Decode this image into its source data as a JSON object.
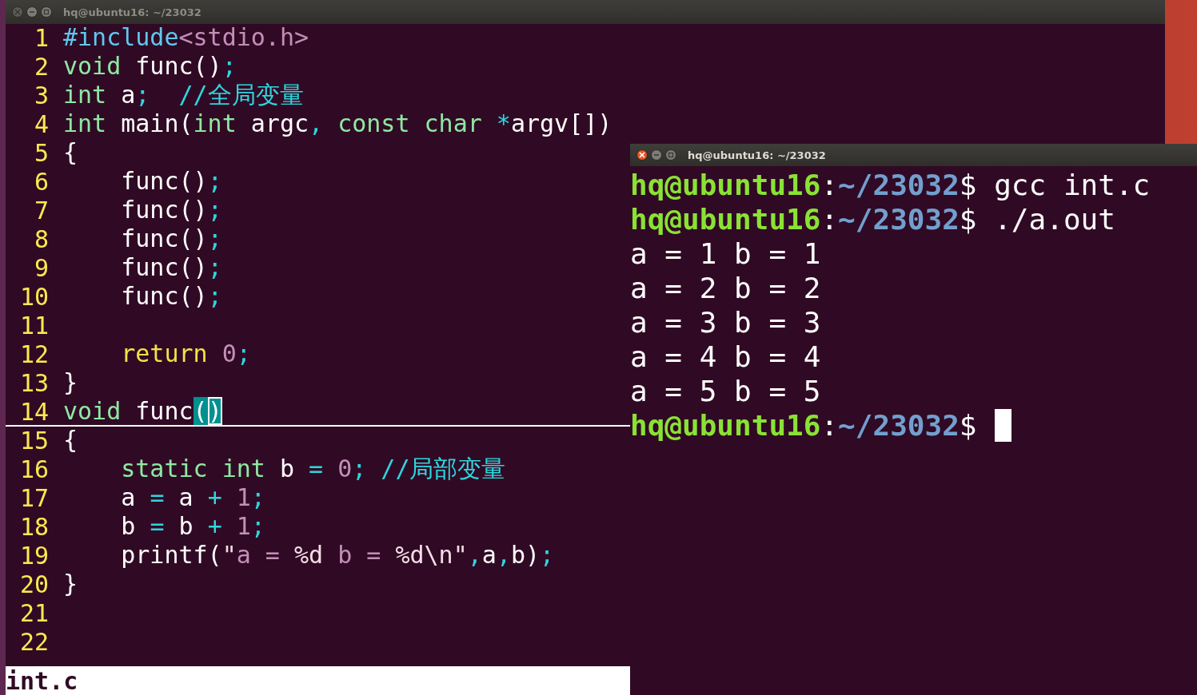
{
  "editor": {
    "title": "hq@ubuntu16: ~/23032",
    "active": false,
    "lines": [
      {
        "number": "1",
        "cursor_line": false,
        "tokens": [
          {
            "text": "#include",
            "kind": "preproc"
          },
          {
            "text": "<stdio.h>",
            "kind": "string"
          }
        ]
      },
      {
        "number": "2",
        "cursor_line": false,
        "tokens": [
          {
            "text": "void",
            "kind": "type"
          },
          {
            "text": " func()",
            "kind": "plain"
          },
          {
            "text": ";",
            "kind": "punct"
          }
        ]
      },
      {
        "number": "3",
        "cursor_line": false,
        "tokens": [
          {
            "text": "int",
            "kind": "type"
          },
          {
            "text": " a",
            "kind": "plain"
          },
          {
            "text": ";",
            "kind": "punct"
          },
          {
            "text": "  //全局变量",
            "kind": "comment"
          }
        ]
      },
      {
        "number": "4",
        "cursor_line": false,
        "tokens": [
          {
            "text": "int",
            "kind": "type"
          },
          {
            "text": " main(",
            "kind": "plain"
          },
          {
            "text": "int",
            "kind": "type"
          },
          {
            "text": " argc",
            "kind": "plain"
          },
          {
            "text": ",",
            "kind": "punct"
          },
          {
            "text": " const",
            "kind": "type"
          },
          {
            "text": " char",
            "kind": "type"
          },
          {
            "text": " *",
            "kind": "punct"
          },
          {
            "text": "argv[])",
            "kind": "plain"
          }
        ]
      },
      {
        "number": "5",
        "cursor_line": false,
        "tokens": [
          {
            "text": "{",
            "kind": "plain"
          }
        ]
      },
      {
        "number": "6",
        "cursor_line": false,
        "tokens": [
          {
            "text": "    func()",
            "kind": "plain"
          },
          {
            "text": ";",
            "kind": "punct"
          }
        ]
      },
      {
        "number": "7",
        "cursor_line": false,
        "tokens": [
          {
            "text": "    func()",
            "kind": "plain"
          },
          {
            "text": ";",
            "kind": "punct"
          }
        ]
      },
      {
        "number": "8",
        "cursor_line": false,
        "tokens": [
          {
            "text": "    func()",
            "kind": "plain"
          },
          {
            "text": ";",
            "kind": "punct"
          }
        ]
      },
      {
        "number": "9",
        "cursor_line": false,
        "tokens": [
          {
            "text": "    func()",
            "kind": "plain"
          },
          {
            "text": ";",
            "kind": "punct"
          }
        ]
      },
      {
        "number": "10",
        "cursor_line": false,
        "tokens": [
          {
            "text": "    func()",
            "kind": "plain"
          },
          {
            "text": ";",
            "kind": "punct"
          }
        ]
      },
      {
        "number": "11",
        "cursor_line": false
      },
      {
        "number": "12",
        "cursor_line": false,
        "tokens": [
          {
            "text": "    return",
            "kind": "keyword"
          },
          {
            "text": " 0",
            "kind": "number"
          },
          {
            "text": ";",
            "kind": "punct"
          }
        ]
      },
      {
        "number": "13",
        "cursor_line": false,
        "tokens": [
          {
            "text": "}",
            "kind": "plain"
          }
        ]
      },
      {
        "number": "14",
        "cursor_line": true,
        "tokens": [
          {
            "text": "void",
            "kind": "type"
          },
          {
            "text": " func",
            "kind": "plain"
          },
          {
            "text": "(",
            "kind": "match"
          },
          {
            "text": ")",
            "kind": "cursor"
          }
        ]
      },
      {
        "number": "15",
        "cursor_line": false,
        "tokens": [
          {
            "text": "{",
            "kind": "plain"
          }
        ]
      },
      {
        "number": "16",
        "cursor_line": false,
        "tokens": [
          {
            "text": "    static",
            "kind": "type"
          },
          {
            "text": " int",
            "kind": "type"
          },
          {
            "text": " b ",
            "kind": "plain"
          },
          {
            "text": "=",
            "kind": "punct"
          },
          {
            "text": " 0",
            "kind": "number"
          },
          {
            "text": ";",
            "kind": "punct"
          },
          {
            "text": " //局部变量",
            "kind": "comment"
          }
        ]
      },
      {
        "number": "17",
        "cursor_line": false,
        "tokens": [
          {
            "text": "    a ",
            "kind": "plain"
          },
          {
            "text": "=",
            "kind": "punct"
          },
          {
            "text": " a ",
            "kind": "plain"
          },
          {
            "text": "+",
            "kind": "punct"
          },
          {
            "text": " 1",
            "kind": "number"
          },
          {
            "text": ";",
            "kind": "punct"
          }
        ]
      },
      {
        "number": "18",
        "cursor_line": false,
        "tokens": [
          {
            "text": "    b ",
            "kind": "plain"
          },
          {
            "text": "=",
            "kind": "punct"
          },
          {
            "text": " b ",
            "kind": "plain"
          },
          {
            "text": "+",
            "kind": "punct"
          },
          {
            "text": " 1",
            "kind": "number"
          },
          {
            "text": ";",
            "kind": "punct"
          }
        ]
      },
      {
        "number": "19",
        "cursor_line": false,
        "tokens": [
          {
            "text": "    printf(",
            "kind": "plain"
          },
          {
            "text": "\"",
            "kind": "special"
          },
          {
            "text": "a = ",
            "kind": "string"
          },
          {
            "text": "%d",
            "kind": "special"
          },
          {
            "text": " b = ",
            "kind": "string"
          },
          {
            "text": "%d\\n\"",
            "kind": "special"
          },
          {
            "text": ",",
            "kind": "punct"
          },
          {
            "text": "a",
            "kind": "plain"
          },
          {
            "text": ",",
            "kind": "punct"
          },
          {
            "text": "b)",
            "kind": "plain"
          },
          {
            "text": ";",
            "kind": "punct"
          }
        ]
      },
      {
        "number": "20",
        "cursor_line": false,
        "tokens": [
          {
            "text": "}",
            "kind": "plain"
          }
        ]
      },
      {
        "number": "21",
        "cursor_line": false
      },
      {
        "number": "22",
        "cursor_line": false
      }
    ],
    "status": "int.c"
  },
  "terminal": {
    "title": "hq@ubuntu16: ~/23032",
    "active": true,
    "lines": [
      {
        "kind": "prompt",
        "user": "hq@ubuntu16",
        "separator": ":",
        "path": "~/23032",
        "symbol": "$",
        "command": " gcc int.c",
        "cursor": false
      },
      {
        "kind": "prompt",
        "user": "hq@ubuntu16",
        "separator": ":",
        "path": "~/23032",
        "symbol": "$",
        "command": " ./a.out",
        "cursor": false
      },
      {
        "kind": "output",
        "text": "a = 1 b = 1",
        "cursor": false
      },
      {
        "kind": "output",
        "text": "a = 2 b = 2",
        "cursor": false
      },
      {
        "kind": "output",
        "text": "a = 3 b = 3",
        "cursor": false
      },
      {
        "kind": "output",
        "text": "a = 4 b = 4",
        "cursor": false
      },
      {
        "kind": "output",
        "text": "a = 5 b = 5",
        "cursor": false
      },
      {
        "kind": "prompt",
        "user": "hq@ubuntu16",
        "separator": ":",
        "path": "~/23032",
        "symbol": "$",
        "cursor": true
      }
    ]
  }
}
